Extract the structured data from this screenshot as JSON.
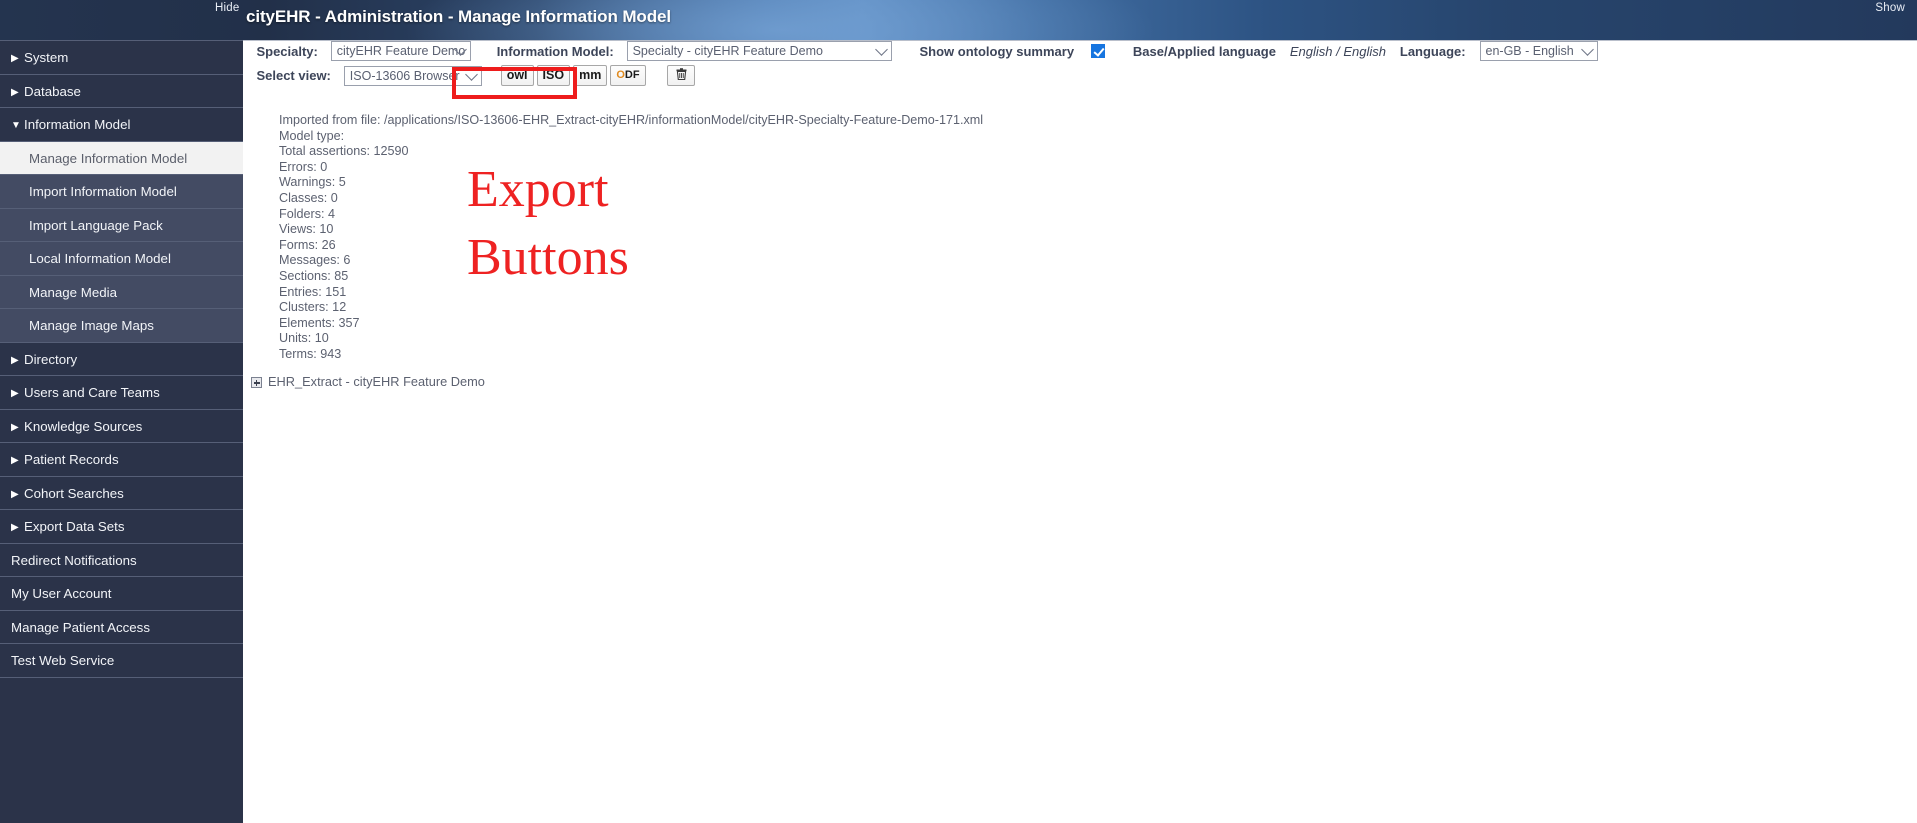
{
  "header": {
    "title": "cityEHR - Administration - Manage Information Model",
    "hide_label": "Hide",
    "show_label": "Show",
    "accent_gradient_from": "#24344f",
    "accent_gradient_to": "#5d8cc2"
  },
  "sidebar": {
    "items": [
      {
        "label": "System",
        "type": "top",
        "arrow": "▶",
        "selected": false
      },
      {
        "label": "Database",
        "type": "top",
        "arrow": "▶",
        "selected": false
      },
      {
        "label": "Information Model",
        "type": "top",
        "arrow": "▼",
        "selected": false
      },
      {
        "label": "Manage Information Model",
        "type": "sub",
        "arrow": "",
        "selected": true
      },
      {
        "label": "Import Information Model",
        "type": "sub",
        "arrow": "",
        "selected": false
      },
      {
        "label": "Import Language Pack",
        "type": "sub",
        "arrow": "",
        "selected": false
      },
      {
        "label": "Local Information Model",
        "type": "sub",
        "arrow": "",
        "selected": false
      },
      {
        "label": "Manage Media",
        "type": "sub",
        "arrow": "",
        "selected": false
      },
      {
        "label": "Manage Image Maps",
        "type": "sub",
        "arrow": "",
        "selected": false
      },
      {
        "label": "Directory",
        "type": "top",
        "arrow": "▶",
        "selected": false
      },
      {
        "label": "Users and Care Teams",
        "type": "top",
        "arrow": "▶",
        "selected": false
      },
      {
        "label": "Knowledge Sources",
        "type": "top",
        "arrow": "▶",
        "selected": false
      },
      {
        "label": "Patient Records",
        "type": "top",
        "arrow": "▶",
        "selected": false
      },
      {
        "label": "Cohort Searches",
        "type": "top",
        "arrow": "▶",
        "selected": false
      },
      {
        "label": "Export Data Sets",
        "type": "top",
        "arrow": "▶",
        "selected": false
      },
      {
        "label": "Redirect Notifications",
        "type": "plain",
        "arrow": "",
        "selected": false
      },
      {
        "label": "My User Account",
        "type": "plain",
        "arrow": "",
        "selected": false
      },
      {
        "label": "Manage Patient Access",
        "type": "plain",
        "arrow": "",
        "selected": false
      },
      {
        "label": "Test Web Service",
        "type": "plain",
        "arrow": "",
        "selected": false
      }
    ]
  },
  "toolbar": {
    "specialty_label": "Specialty:",
    "specialty_value": "cityEHR Feature Demo",
    "information_model_label": "Information Model:",
    "information_model_value": "Specialty - cityEHR Feature Demo",
    "show_ontology_summary_label": "Show ontology summary",
    "show_ontology_summary_checked": true,
    "base_applied_language_label": "Base/Applied language",
    "base_applied_language_value": "English / English",
    "language_label": "Language:",
    "language_value": "en-GB - English",
    "select_view_label": "Select view:",
    "select_view_value": "ISO-13606 Browser",
    "export_buttons": [
      {
        "label": "owl",
        "name": "export-owl-button"
      },
      {
        "label": "ISO",
        "name": "export-iso-button"
      },
      {
        "label": "mm",
        "name": "export-mm-button"
      },
      {
        "label": "ODF",
        "name": "export-odf-button"
      }
    ],
    "delete_button_icon": "trash-icon",
    "delete_button_glyph": "🗑",
    "highlight_color": "#ee1c1c"
  },
  "annotation": {
    "line1": "Export",
    "line2": "Buttons",
    "color": "#ee2222"
  },
  "summary": {
    "lines": [
      "Imported from file: /applications/ISO-13606-EHR_Extract-cityEHR/informationModel/cityEHR-Specialty-Feature-Demo-171.xml",
      "Model type:",
      "Total assertions: 12590",
      "Errors: 0",
      "Warnings: 5",
      "Classes: 0",
      "Folders: 4",
      "Views: 10",
      "Forms: 26",
      "Messages: 6",
      "Sections: 85",
      "Entries: 151",
      "Clusters: 12",
      "Elements: 357",
      "Units: 10",
      "Terms: 943"
    ]
  },
  "tree": {
    "root_label": "EHR_Extract - cityEHR Feature Demo",
    "expanded": false
  }
}
